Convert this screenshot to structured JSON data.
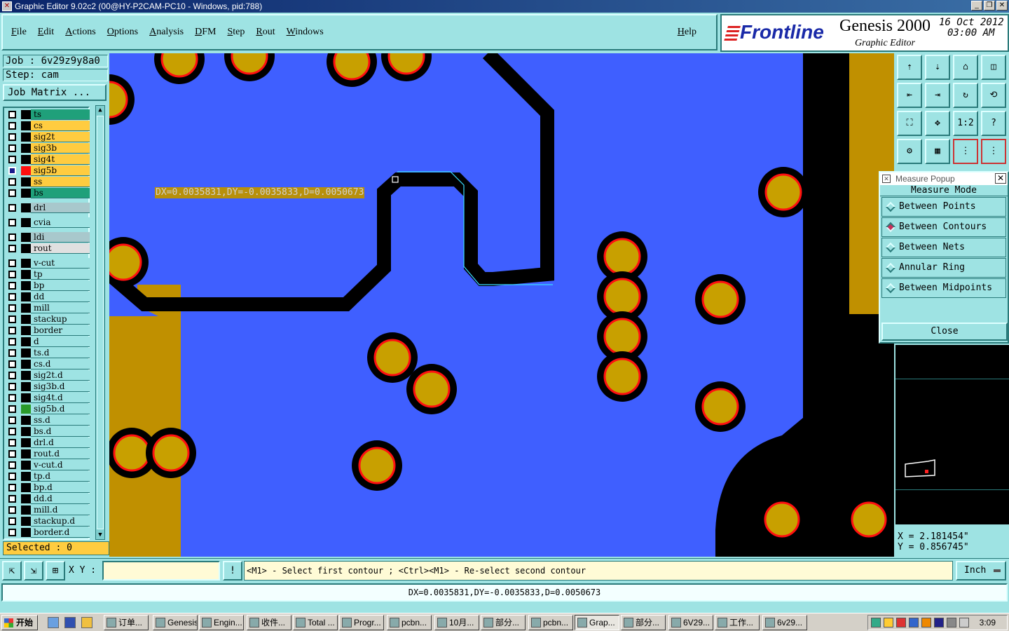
{
  "window": {
    "title": "Graphic Editor 9.02c2 (00@HY-P2CAM-PC10 - Windows, pid:788)"
  },
  "menu": {
    "items": [
      "File",
      "Edit",
      "Actions",
      "Options",
      "Analysis",
      "DFM",
      "Step",
      "Rout",
      "Windows"
    ],
    "help": "Help"
  },
  "logo": {
    "brand": "Frontline",
    "product": "Genesis 2000",
    "date": "16 Oct 2012",
    "time": "03:00 AM",
    "subtitle": "Graphic Editor"
  },
  "job": {
    "job_line": "Job : 6v29z9y8a0",
    "step_line": "Step: cam",
    "matrix_button": "Job Matrix ..."
  },
  "layers": [
    {
      "name": "ts",
      "bg": "#1fa07a",
      "swatch": "#000000",
      "checked": false
    },
    {
      "name": "cs",
      "bg": "#ffcc40",
      "swatch": "#000000",
      "checked": false
    },
    {
      "name": "sig2t",
      "bg": "#ffcc40",
      "swatch": "#000000",
      "checked": false
    },
    {
      "name": "sig3b",
      "bg": "#ffcc40",
      "swatch": "#000000",
      "checked": false
    },
    {
      "name": "sig4t",
      "bg": "#ffcc40",
      "swatch": "#000000",
      "checked": false
    },
    {
      "name": "sig5b",
      "bg": "#ffcc40",
      "swatch": "#ff1010",
      "checked": true
    },
    {
      "name": "ss",
      "bg": "#ffcc40",
      "swatch": "#000000",
      "checked": false
    },
    {
      "name": "bs",
      "bg": "#1fa07a",
      "swatch": "#000000",
      "checked": false
    },
    {
      "name": "drl",
      "bg": "#a8c8cc",
      "swatch": "#000000",
      "checked": false,
      "gap": true
    },
    {
      "name": "cvia",
      "bg": "#9ee3e3",
      "swatch": "#000000",
      "checked": false,
      "gap": true
    },
    {
      "name": "ldi",
      "bg": "#a8c8cc",
      "swatch": "#000000",
      "checked": false,
      "gap": true
    },
    {
      "name": "rout",
      "bg": "#e0e0e0",
      "swatch": "#000000",
      "checked": false
    },
    {
      "name": "v-cut",
      "bg": "#9ee3e3",
      "swatch": "#000000",
      "checked": false,
      "gap": true
    },
    {
      "name": "tp",
      "bg": "#9ee3e3",
      "swatch": "#000000",
      "checked": false
    },
    {
      "name": "bp",
      "bg": "#9ee3e3",
      "swatch": "#000000",
      "checked": false
    },
    {
      "name": "dd",
      "bg": "#9ee3e3",
      "swatch": "#000000",
      "checked": false
    },
    {
      "name": "mill",
      "bg": "#9ee3e3",
      "swatch": "#000000",
      "checked": false
    },
    {
      "name": "stackup",
      "bg": "#9ee3e3",
      "swatch": "#000000",
      "checked": false
    },
    {
      "name": "border",
      "bg": "#9ee3e3",
      "swatch": "#000000",
      "checked": false
    },
    {
      "name": "d",
      "bg": "#9ee3e3",
      "swatch": "#000000",
      "checked": false
    },
    {
      "name": "ts.d",
      "bg": "#9ee3e3",
      "swatch": "#000000",
      "checked": false
    },
    {
      "name": "cs.d",
      "bg": "#9ee3e3",
      "swatch": "#000000",
      "checked": false
    },
    {
      "name": "sig2t.d",
      "bg": "#9ee3e3",
      "swatch": "#000000",
      "checked": false
    },
    {
      "name": "sig3b.d",
      "bg": "#9ee3e3",
      "swatch": "#000000",
      "checked": false
    },
    {
      "name": "sig4t.d",
      "bg": "#9ee3e3",
      "swatch": "#000000",
      "checked": false
    },
    {
      "name": "sig5b.d",
      "bg": "#9ee3e3",
      "swatch": "#2a9a2a",
      "checked": false
    },
    {
      "name": "ss.d",
      "bg": "#9ee3e3",
      "swatch": "#000000",
      "checked": false
    },
    {
      "name": "bs.d",
      "bg": "#9ee3e3",
      "swatch": "#000000",
      "checked": false
    },
    {
      "name": "drl.d",
      "bg": "#9ee3e3",
      "swatch": "#000000",
      "checked": false
    },
    {
      "name": "rout.d",
      "bg": "#9ee3e3",
      "swatch": "#000000",
      "checked": false
    },
    {
      "name": "v-cut.d",
      "bg": "#9ee3e3",
      "swatch": "#000000",
      "checked": false
    },
    {
      "name": "tp.d",
      "bg": "#9ee3e3",
      "swatch": "#000000",
      "checked": false
    },
    {
      "name": "bp.d",
      "bg": "#9ee3e3",
      "swatch": "#000000",
      "checked": false
    },
    {
      "name": "dd.d",
      "bg": "#9ee3e3",
      "swatch": "#000000",
      "checked": false
    },
    {
      "name": "mill.d",
      "bg": "#9ee3e3",
      "swatch": "#000000",
      "checked": false
    },
    {
      "name": "stackup.d",
      "bg": "#9ee3e3",
      "swatch": "#000000",
      "checked": false
    },
    {
      "name": "border.d",
      "bg": "#9ee3e3",
      "swatch": "#000000",
      "checked": false
    }
  ],
  "selected": "Selected : 0",
  "canvas": {
    "measure_label": "DX=0.0035831,DY=-0.0035833,D=0.0050673",
    "colors": {
      "copper": "#3f5fff",
      "pad": "#c8a000",
      "outline": "#ff1010",
      "board": "#c09000",
      "background": "#000000"
    }
  },
  "toolbar": {
    "buttons": [
      "home-up-icon",
      "home-down-icon",
      "home-icon",
      "window-icon",
      "pan-left-icon",
      "pan-right-icon",
      "redraw-icon",
      "snap-icon",
      "zoom-fit-icon",
      "zoom-center-icon",
      "zoom-1-2-icon",
      "help-icon",
      "wrench-icon",
      "grid-icon",
      "layer-display-icon",
      "layer-display-2-icon"
    ],
    "zoom_label": "1:2",
    "help_label": "?"
  },
  "measure_popup": {
    "title": "Measure Popup",
    "mode_heading": "Measure Mode",
    "options": [
      "Between Points",
      "Between Contours",
      "Between Nets",
      "Annular Ring",
      "Between Midpoints"
    ],
    "selected_option": "Between Contours",
    "close_label": "Close"
  },
  "coords": {
    "x": "X = 2.181454\"",
    "y": "Y = 0.856745\""
  },
  "command": {
    "xy_label": "X Y :",
    "xy_value": "",
    "prompt": "<M1> - Select first contour ; <Ctrl><M1> - Re-select second contour",
    "unit": "Inch",
    "status": "DX=0.0035831,DY=-0.0035833,D=0.0050673"
  },
  "taskbar": {
    "start": "开始",
    "tasks": [
      "订单...",
      "Genesis",
      "Engin...",
      "收件...",
      "Total ...",
      "Progr...",
      "pcbn...",
      "10月...",
      "部分...",
      "pcbn...",
      "Grap...",
      "部分...",
      "6V29...",
      "工作...",
      "6v29..."
    ],
    "active_task": "Grap...",
    "clock": "3:09"
  }
}
